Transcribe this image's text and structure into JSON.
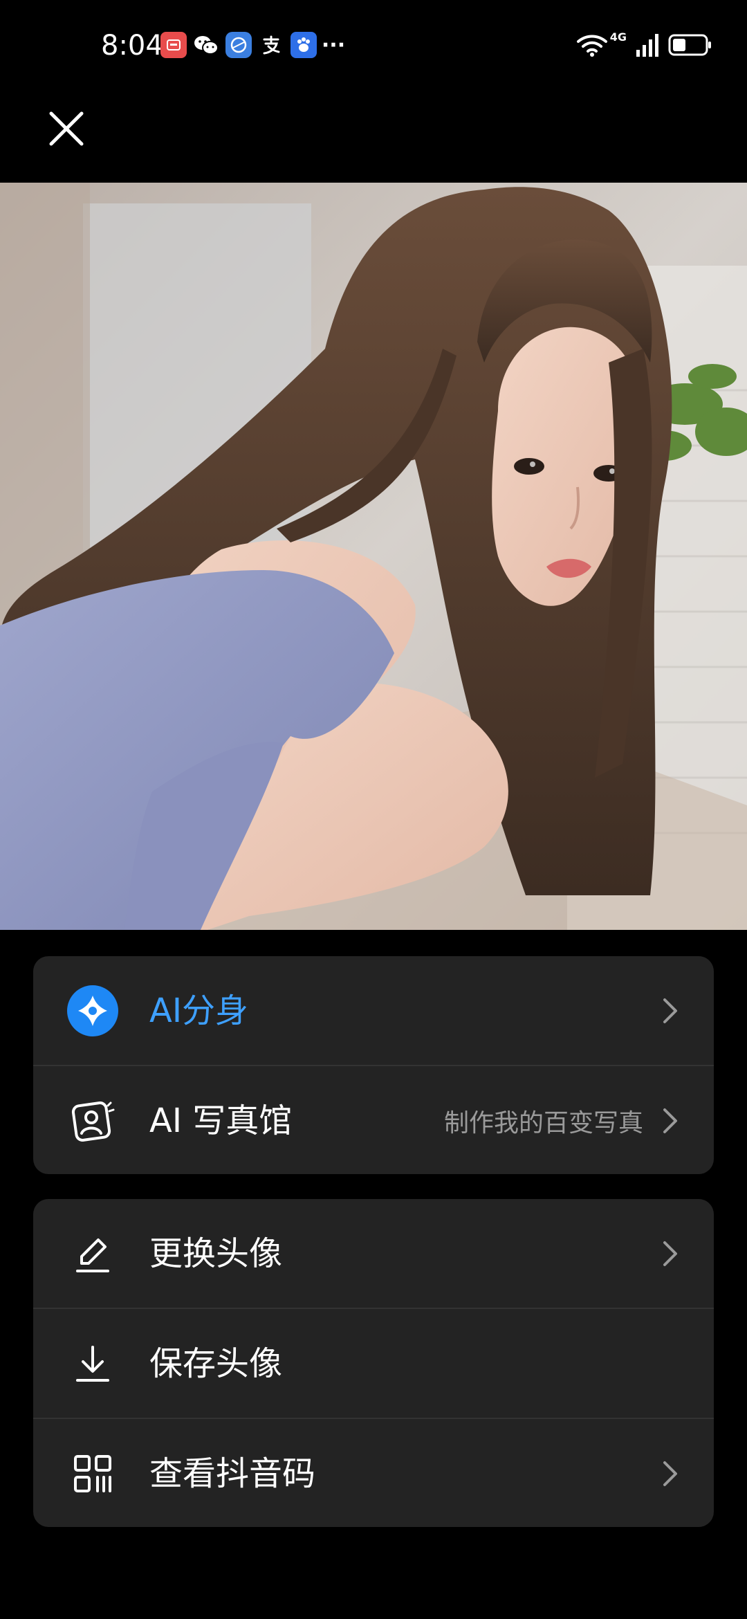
{
  "status_bar": {
    "time": "8:04",
    "notification_icons": [
      "huawei-app-icon",
      "wechat-icon",
      "browser-icon",
      "alipay-icon",
      "baidu-icon"
    ],
    "more": "···",
    "network": "4G",
    "battery_level": 0.4
  },
  "close_icon": "close-icon",
  "ai_card": {
    "ai_clone": {
      "label": "AI分身",
      "icon": "ai-spark-icon",
      "color": "#3ea0ff"
    },
    "ai_studio": {
      "label": "AI 写真馆",
      "sub": "制作我的百变写真",
      "icon": "portrait-frame-icon"
    }
  },
  "actions_card": {
    "change_avatar": {
      "label": "更换头像",
      "icon": "edit-pen-icon"
    },
    "save_avatar": {
      "label": "保存头像",
      "icon": "download-icon"
    },
    "view_code": {
      "label": "查看抖音码",
      "icon": "qr-code-icon"
    }
  },
  "colors": {
    "background": "#000000",
    "card": "#232323",
    "accent_blue": "#3ea0ff",
    "secondary_text": "#9a9a9a"
  }
}
